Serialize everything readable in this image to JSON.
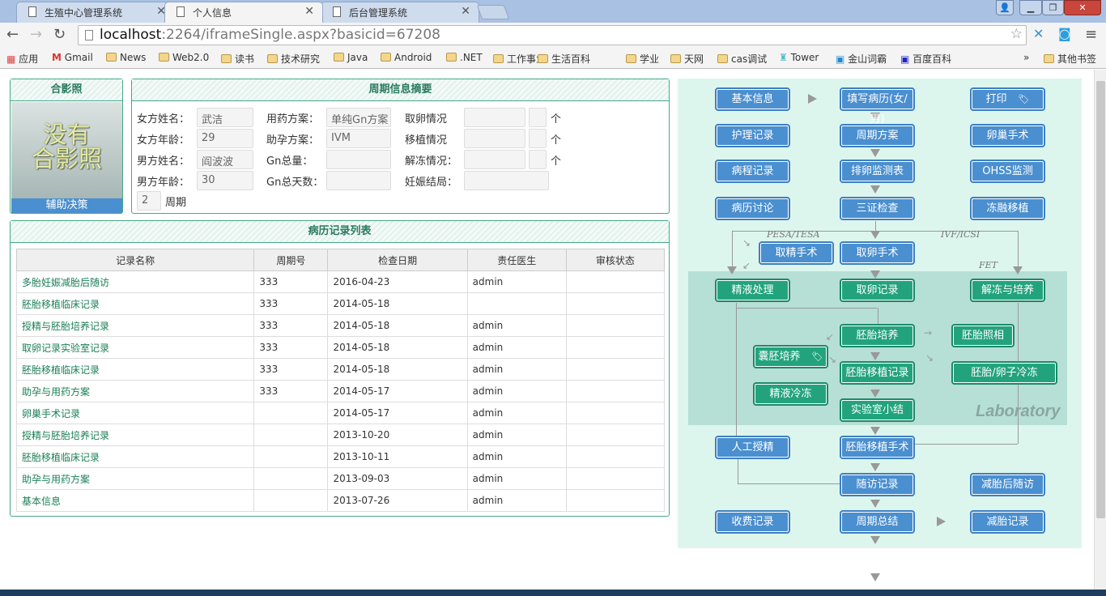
{
  "browser": {
    "tabs": [
      {
        "title": "生殖中心管理系统",
        "active": false
      },
      {
        "title": "个人信息",
        "active": true
      },
      {
        "title": "后台管理系统",
        "active": false
      }
    ],
    "url_host": "localhost",
    "url_rest": ":2264/iframeSingle.aspx?basicid=67208",
    "bookmarks": [
      "应用",
      "Gmail",
      "News",
      "Web2.0",
      "读书",
      "技术研究",
      "Java",
      "Android",
      ".NET",
      "工作事业",
      "生活百科",
      "学业",
      "天网",
      "cas调试",
      "Tower",
      "金山词霸",
      "百度百科"
    ],
    "other_bookmarks": "其他书签"
  },
  "photo": {
    "title": "合影照",
    "placeholder_line1": "没有",
    "placeholder_line2": "合影照",
    "assist": "辅助决策"
  },
  "summary": {
    "title": "周期信息摘要",
    "fields": [
      {
        "label": "女方姓名：",
        "value": "武洁"
      },
      {
        "label": "女方年龄：",
        "value": "29"
      },
      {
        "label": "男方姓名：",
        "value": "阎波波"
      },
      {
        "label": "男方年龄：",
        "value": "30"
      },
      {
        "label": "用药方案：",
        "value": "单纯Gn方案"
      },
      {
        "label": "助孕方案：",
        "value": "IVM"
      },
      {
        "label": "Gn总量：",
        "value": ""
      },
      {
        "label": "Gn总天数：",
        "value": ""
      },
      {
        "label": "取卵情况",
        "value": "",
        "count": "",
        "unit": "个"
      },
      {
        "label": "移植情况",
        "value": "",
        "count": "",
        "unit": "个"
      },
      {
        "label": "解冻情况：",
        "value": "",
        "count": "",
        "unit": "个"
      },
      {
        "label": "妊娠结局：",
        "value": ""
      }
    ],
    "cycle_value": "2",
    "cycle_label": "周期"
  },
  "records": {
    "title": "病历记录列表",
    "columns": [
      "记录名称",
      "周期号",
      "检查日期",
      "责任医生",
      "审核状态"
    ],
    "rows": [
      [
        "多胎妊娠减胎后随访",
        "333",
        "2016-04-23",
        "admin",
        ""
      ],
      [
        "胚胎移植临床记录",
        "333",
        "2014-05-18",
        "",
        ""
      ],
      [
        "授精与胚胎培养记录",
        "333",
        "2014-05-18",
        "admin",
        ""
      ],
      [
        "取卵记录实验室记录",
        "333",
        "2014-05-18",
        "admin",
        ""
      ],
      [
        "胚胎移植临床记录",
        "333",
        "2014-05-18",
        "admin",
        ""
      ],
      [
        "助孕与用药方案",
        "333",
        "2014-05-17",
        "admin",
        ""
      ],
      [
        "卵巢手术记录",
        "",
        "2014-05-17",
        "admin",
        ""
      ],
      [
        "授精与胚胎培养记录",
        "",
        "2013-10-20",
        "admin",
        ""
      ],
      [
        "胚胎移植临床记录",
        "",
        "2013-10-11",
        "admin",
        ""
      ],
      [
        "助孕与用药方案",
        "",
        "2013-09-03",
        "admin",
        ""
      ],
      [
        "基本信息",
        "",
        "2013-07-26",
        "admin",
        ""
      ]
    ]
  },
  "flow": {
    "lab_label": "Laboratory",
    "annotations": {
      "pesa": "PESA/TESA",
      "ivf": "IVF/ICSI",
      "fet": "FET"
    },
    "buttons": {
      "basic": "基本信息",
      "history": "填写病历(女/男)",
      "print": "打印",
      "nursing": "护理记录",
      "plan": "周期方案",
      "ovary": "卵巢手术",
      "course": "病程记录",
      "monitor": "排卵监测表",
      "ohss": "OHSS监测",
      "discuss": "病历讨论",
      "check": "三证检查",
      "frozen": "冻融移植",
      "sperm_op": "取精手术",
      "egg_op": "取卵手术",
      "semen": "精液处理",
      "egg_rec": "取卵记录",
      "thaw": "解冻与培养",
      "culture": "胚胎培养",
      "photo": "胚胎照相",
      "blast": "囊胚培养",
      "transfer_rec": "胚胎移植记录",
      "freeze": "胚胎/卵子冷冻",
      "semen_freeze": "精液冷冻",
      "summary": "实验室小结",
      "iui": "人工授精",
      "transfer_op": "胚胎移植手术",
      "followup": "随访记录",
      "reduce_follow": "减胎后随访",
      "fee": "收费记录",
      "cycle_sum": "周期总结",
      "reduce": "减胎记录"
    }
  },
  "colors": {
    "blue": "#4a8fcf",
    "green": "#23a37d",
    "panel": "#dcf6ee",
    "lab": "#b6dfd5"
  }
}
